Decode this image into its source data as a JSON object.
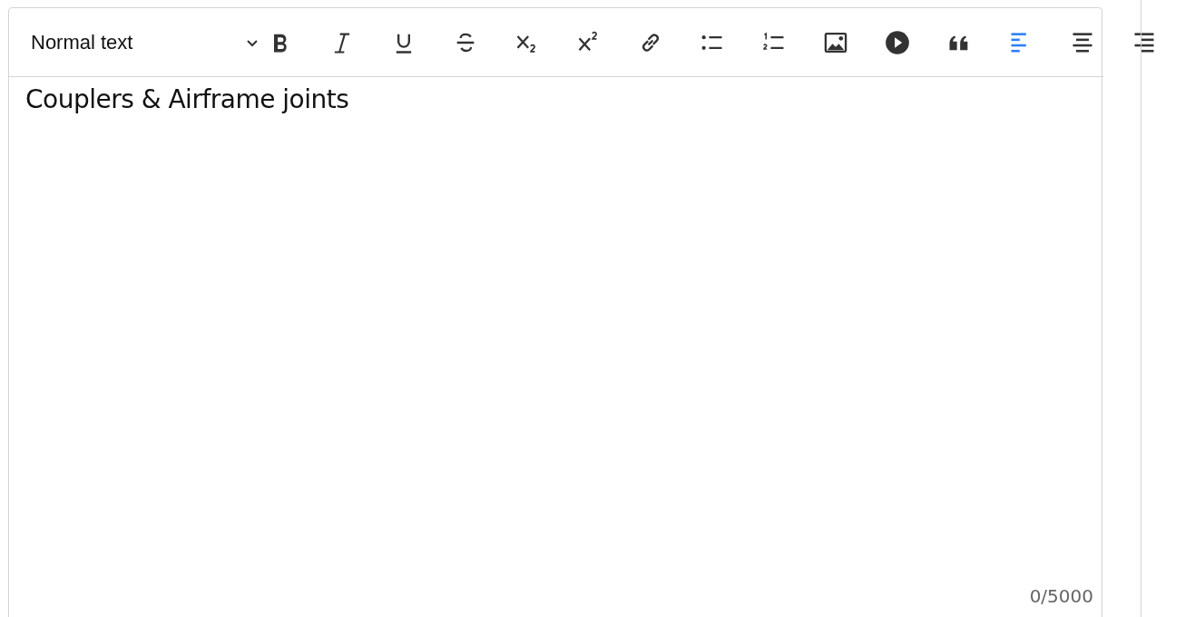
{
  "toolbar": {
    "block_style": {
      "value": "Normal text"
    },
    "format_buttons": [
      {
        "kind": "bold"
      },
      {
        "kind": "italic"
      },
      {
        "kind": "underline"
      },
      {
        "kind": "strikethrough"
      },
      {
        "kind": "subscript"
      },
      {
        "kind": "superscript"
      },
      {
        "kind": "link"
      },
      {
        "kind": "bulleted-list"
      },
      {
        "kind": "numbered-list"
      },
      {
        "kind": "image"
      },
      {
        "kind": "video"
      },
      {
        "kind": "quote"
      }
    ],
    "alignment": [
      {
        "kind": "left",
        "selected": true
      },
      {
        "kind": "center",
        "selected": false
      },
      {
        "kind": "right",
        "selected": false
      }
    ]
  },
  "editor": {
    "content": "Couplers & Airframe joints",
    "counter": "0/5000"
  }
}
